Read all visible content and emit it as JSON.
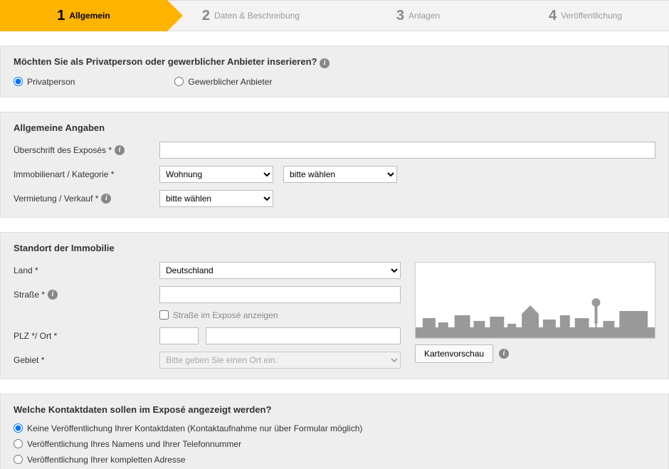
{
  "steps": [
    {
      "num": "1",
      "label": "Allgemein"
    },
    {
      "num": "2",
      "label": "Daten & Beschreibung"
    },
    {
      "num": "3",
      "label": "Anlagen"
    },
    {
      "num": "4",
      "label": "Veröffentlichung"
    }
  ],
  "provider": {
    "question": "Möchten Sie als Privatperson oder gewerblicher Anbieter inserieren?",
    "opt1": "Privatperson",
    "opt2": "Gewerblicher Anbieter"
  },
  "general": {
    "title": "Allgemeine Angaben",
    "expose_label": "Überschrift des Exposés *",
    "category_label": "Immobilienart / Kategorie *",
    "cat1": "Wohnung",
    "cat2": "bitte wählen",
    "rent_label": "Vermietung / Verkauf *",
    "rent_val": "bitte wählen"
  },
  "location": {
    "title": "Standort der Immobilie",
    "country_label": "Land *",
    "country_val": "Deutschland",
    "street_label": "Straße *",
    "street_cb": "Straße im Exposé anzeigen",
    "plz_label": "PLZ */ Ort *",
    "area_label": "Gebiet *",
    "area_placeholder": "Bitte geben Sie einen Ort ein.",
    "map_btn": "Kartenvorschau"
  },
  "contact": {
    "title": "Welche Kontaktdaten sollen im Exposé angezeigt werden?",
    "opt1": "Keine Veröffentlichung Ihrer Kontaktdaten (Kontaktaufnahme nur über Formular möglich)",
    "opt2": "Veröffentlichung Ihres Namens und Ihrer Telefonnummer",
    "opt3": "Veröffentlichung Ihrer kompletten Adresse"
  }
}
